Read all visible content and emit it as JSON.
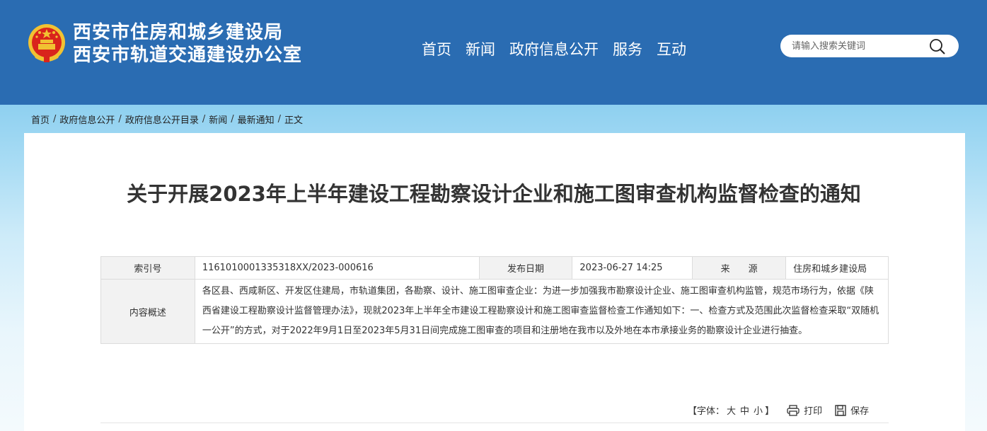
{
  "header": {
    "title_line1": "西安市住房和城乡建设局",
    "title_line2": "西安市轨道交通建设办公室",
    "nav": [
      "首页",
      "新闻",
      "政府信息公开",
      "服务",
      "互动"
    ],
    "search_placeholder": "请输入搜索关键词"
  },
  "breadcrumb": [
    "首页",
    "政府信息公开",
    "政府信息公开目录",
    "新闻",
    "最新通知",
    "正文"
  ],
  "article": {
    "title": "关于开展2023年上半年建设工程勘察设计企业和施工图审查机构监督检查的通知",
    "meta": {
      "index_label": "索引号",
      "index_value": "1161010001335318XX/2023-000616",
      "date_label": "发布日期",
      "date_value": "2023-06-27 14:25",
      "source_label": "来　　源",
      "source_value": "住房和城乡建设局",
      "summary_label": "内容概述",
      "summary_value": "各区县、西咸新区、开发区住建局，市轨道集团，各勘察、设计、施工图审查企业：为进一步加强我市勘察设计企业、施工图审查机构监管，规范市场行为，依据《陕西省建设工程勘察设计监督管理办法》，现就2023年上半年全市建设工程勘察设计和施工图审查监督检查工作通知如下：一、检查方式及范围此次监督检查采取“双随机一公开”的方式，对于2022年9月1日至2023年5月31日间完成施工图审查的项目和注册地在我市以及外地在本市承接业务的勘察设计企业进行抽查。"
    }
  },
  "tools": {
    "font_label_open": "【字体：",
    "font_large": "大",
    "font_medium": "中",
    "font_small": "小",
    "font_label_close": "】",
    "print": "打印",
    "save": "保存"
  },
  "colors": {
    "header_bg": "#2a6cb2",
    "emblem_red": "#d9241c",
    "emblem_gold": "#f1c232"
  }
}
